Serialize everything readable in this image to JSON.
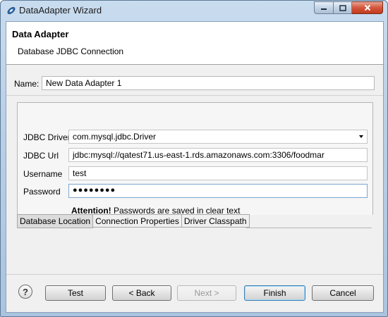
{
  "window": {
    "title": "DataAdapter Wizard"
  },
  "header": {
    "title": "Data Adapter",
    "subtitle": "Database JDBC Connection"
  },
  "name": {
    "label": "Name:",
    "value": "New Data Adapter 1"
  },
  "jdbc": {
    "driver_label": "JDBC Driver",
    "driver_value": "com.mysql.jdbc.Driver",
    "url_label": "JDBC Url",
    "url_value": "jdbc:mysql://qatest71.us-east-1.rds.amazonaws.com:3306/foodmar",
    "username_label": "Username",
    "username_value": "test",
    "password_label": "Password",
    "password_value": "●●●●●●●●",
    "attention_bold": "Attention!",
    "attention_text": " Passwords are saved in clear text"
  },
  "tabs": [
    "Database Location",
    "Connection Properties",
    "Driver Classpath"
  ],
  "buttons": {
    "help": "?",
    "test": "Test",
    "back": "< Back",
    "next": "Next >",
    "finish": "Finish",
    "cancel": "Cancel"
  },
  "colors": {
    "accent": "#3c7fb1",
    "title_gradient": "#b9cfe6",
    "close": "#c23b1e"
  }
}
